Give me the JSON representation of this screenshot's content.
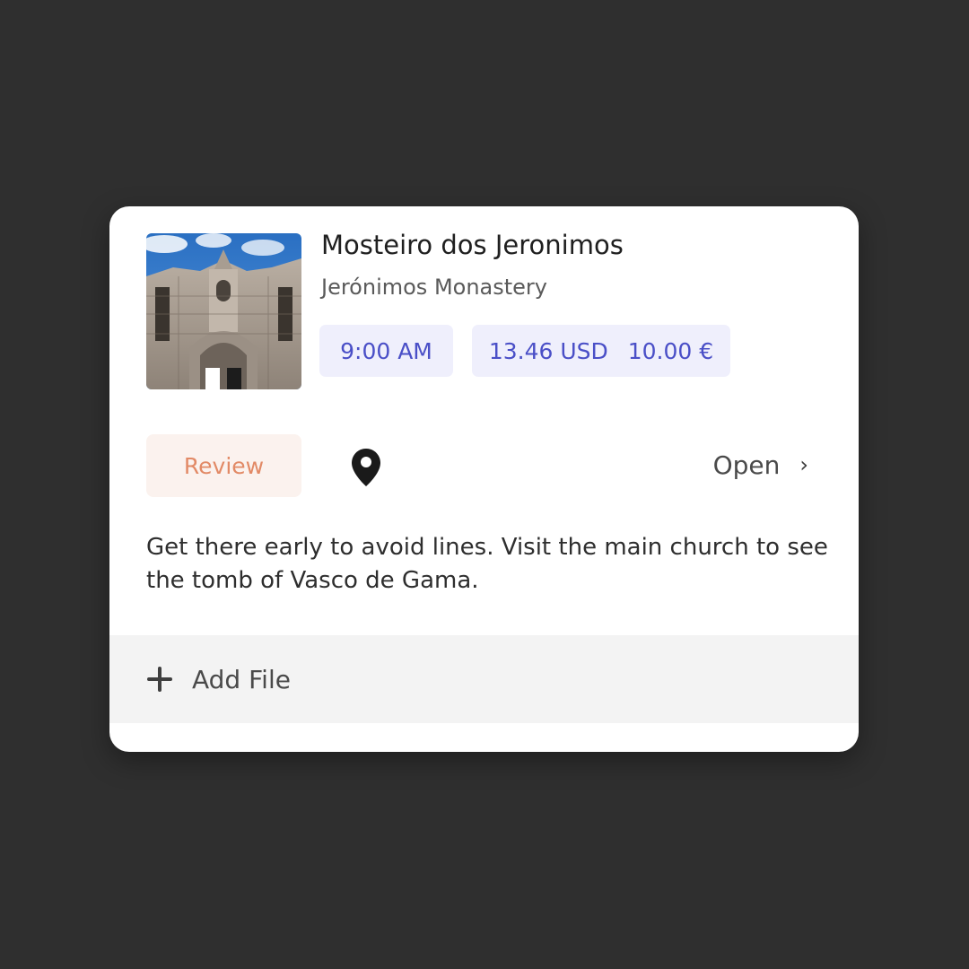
{
  "place": {
    "title": "Mosteiro dos Jeronimos",
    "subtitle": "Jerónimos Monastery",
    "image_alt": "Jerónimos Monastery facade",
    "time": "9:00 AM",
    "price_usd": "13.46 USD",
    "price_eur": "10.00 €"
  },
  "actions": {
    "review_label": "Review",
    "location_icon": "map-pin-icon",
    "open_label": "Open",
    "open_icon": "chevron-right-icon"
  },
  "note": "Get there early to avoid lines. Visit the main church to see the tomb of Vasco de Gama.",
  "files": {
    "add_label": "Add File",
    "add_icon": "plus-icon"
  },
  "colors": {
    "background": "#2f2f2f",
    "card": "#ffffff",
    "chip_bg": "#efeffc",
    "chip_text": "#4a4fc7",
    "review_bg": "#fbf2ee",
    "review_text": "#e28a66",
    "file_bar_bg": "#f3f3f3"
  }
}
